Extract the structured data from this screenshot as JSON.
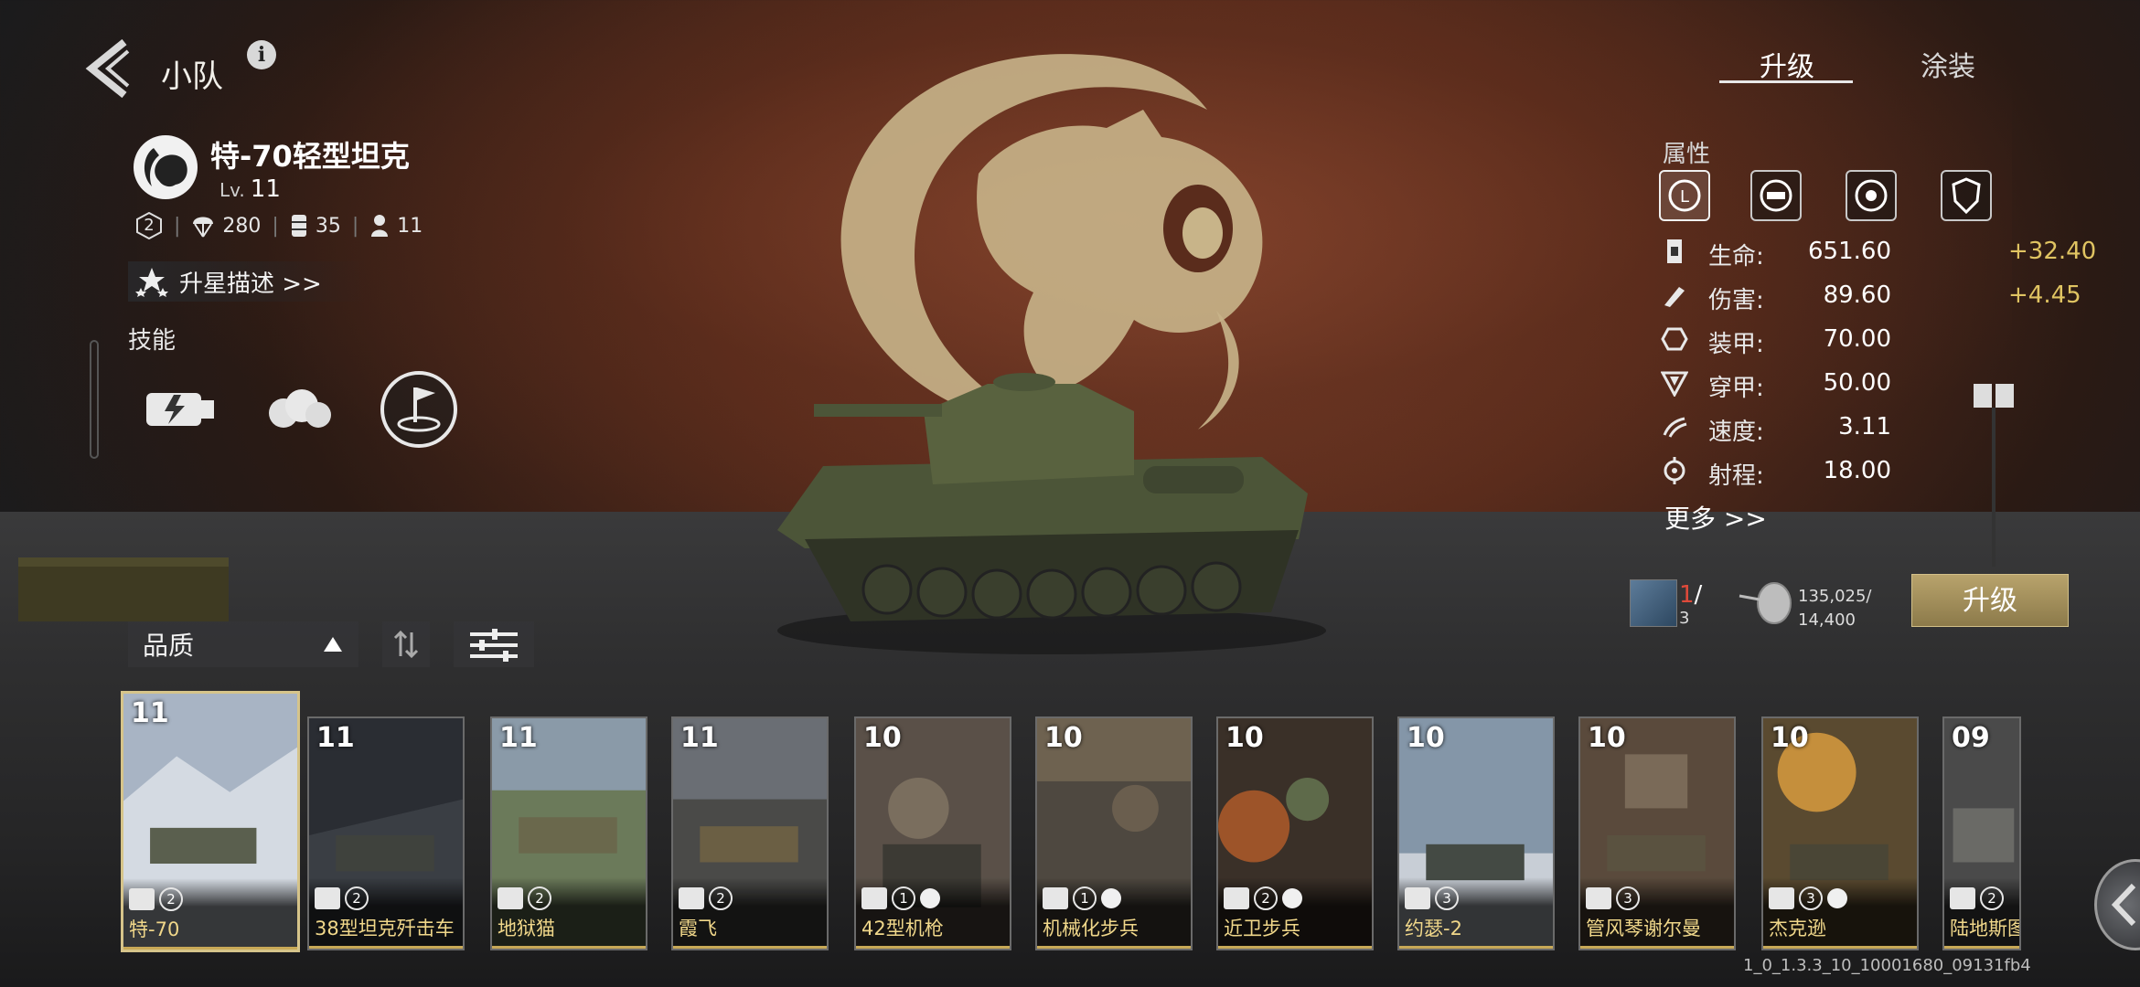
{
  "header": {
    "title": "小队",
    "info": "i"
  },
  "unit": {
    "name": "特-70轻型坦克",
    "level_prefix": "Lv.",
    "level": "11",
    "tier": "2",
    "stat_a": "280",
    "stat_b": "35",
    "stat_c": "11",
    "star_desc": "升星描述 >>"
  },
  "skills": {
    "label": "技能"
  },
  "tabs": {
    "upgrade": "升级",
    "paint": "涂装"
  },
  "attributes": {
    "label": "属性",
    "stats": [
      {
        "icon": "life-icon",
        "name": "生命:",
        "value": "651.60",
        "bonus": "+32.40"
      },
      {
        "icon": "damage-icon",
        "name": "伤害:",
        "value": "89.60",
        "bonus": "+4.45"
      },
      {
        "icon": "armor-icon",
        "name": "装甲:",
        "value": "70.00",
        "bonus": ""
      },
      {
        "icon": "penetration-icon",
        "name": "穿甲:",
        "value": "50.00",
        "bonus": ""
      },
      {
        "icon": "speed-icon",
        "name": "速度:",
        "value": "3.11",
        "bonus": ""
      },
      {
        "icon": "range-icon",
        "name": "射程:",
        "value": "18.00",
        "bonus": ""
      }
    ],
    "more": "更多 >>"
  },
  "upgrade_cost": {
    "cards_have": "1",
    "cards_sep": "/",
    "cards_need": "3",
    "silver_have": "135,025/",
    "silver_need": "14,400",
    "button": "升级"
  },
  "filters": {
    "quality": "品质"
  },
  "cards": [
    {
      "level": "11",
      "name": "特-70",
      "tier": "2",
      "type": "tank"
    },
    {
      "level": "11",
      "name": "38型坦克歼击车",
      "tier": "2",
      "type": "tank"
    },
    {
      "level": "11",
      "name": "地狱猫",
      "tier": "2",
      "type": "tank"
    },
    {
      "level": "11",
      "name": "霞飞",
      "tier": "2",
      "type": "tank"
    },
    {
      "level": "10",
      "name": "42型机枪",
      "tier": "1",
      "type": "infantry"
    },
    {
      "level": "10",
      "name": "机械化步兵",
      "tier": "1",
      "type": "infantry"
    },
    {
      "level": "10",
      "name": "近卫步兵",
      "tier": "2",
      "type": "infantry"
    },
    {
      "level": "10",
      "name": "约瑟-2",
      "tier": "3",
      "type": "tank"
    },
    {
      "level": "10",
      "name": "管风琴谢尔曼",
      "tier": "3",
      "type": "tank"
    },
    {
      "level": "10",
      "name": "杰克逊",
      "tier": "3",
      "type": "tank"
    },
    {
      "level": "09",
      "name": "陆地斯图",
      "tier": "2",
      "type": "tank"
    }
  ],
  "footer": {
    "build_id": "1_0_1.3.3_10_10001680_09131fb4"
  },
  "colors": {
    "accent_gold": "#d6c48a",
    "bonus": "#e0c462",
    "count_red": "#e04a3a"
  }
}
